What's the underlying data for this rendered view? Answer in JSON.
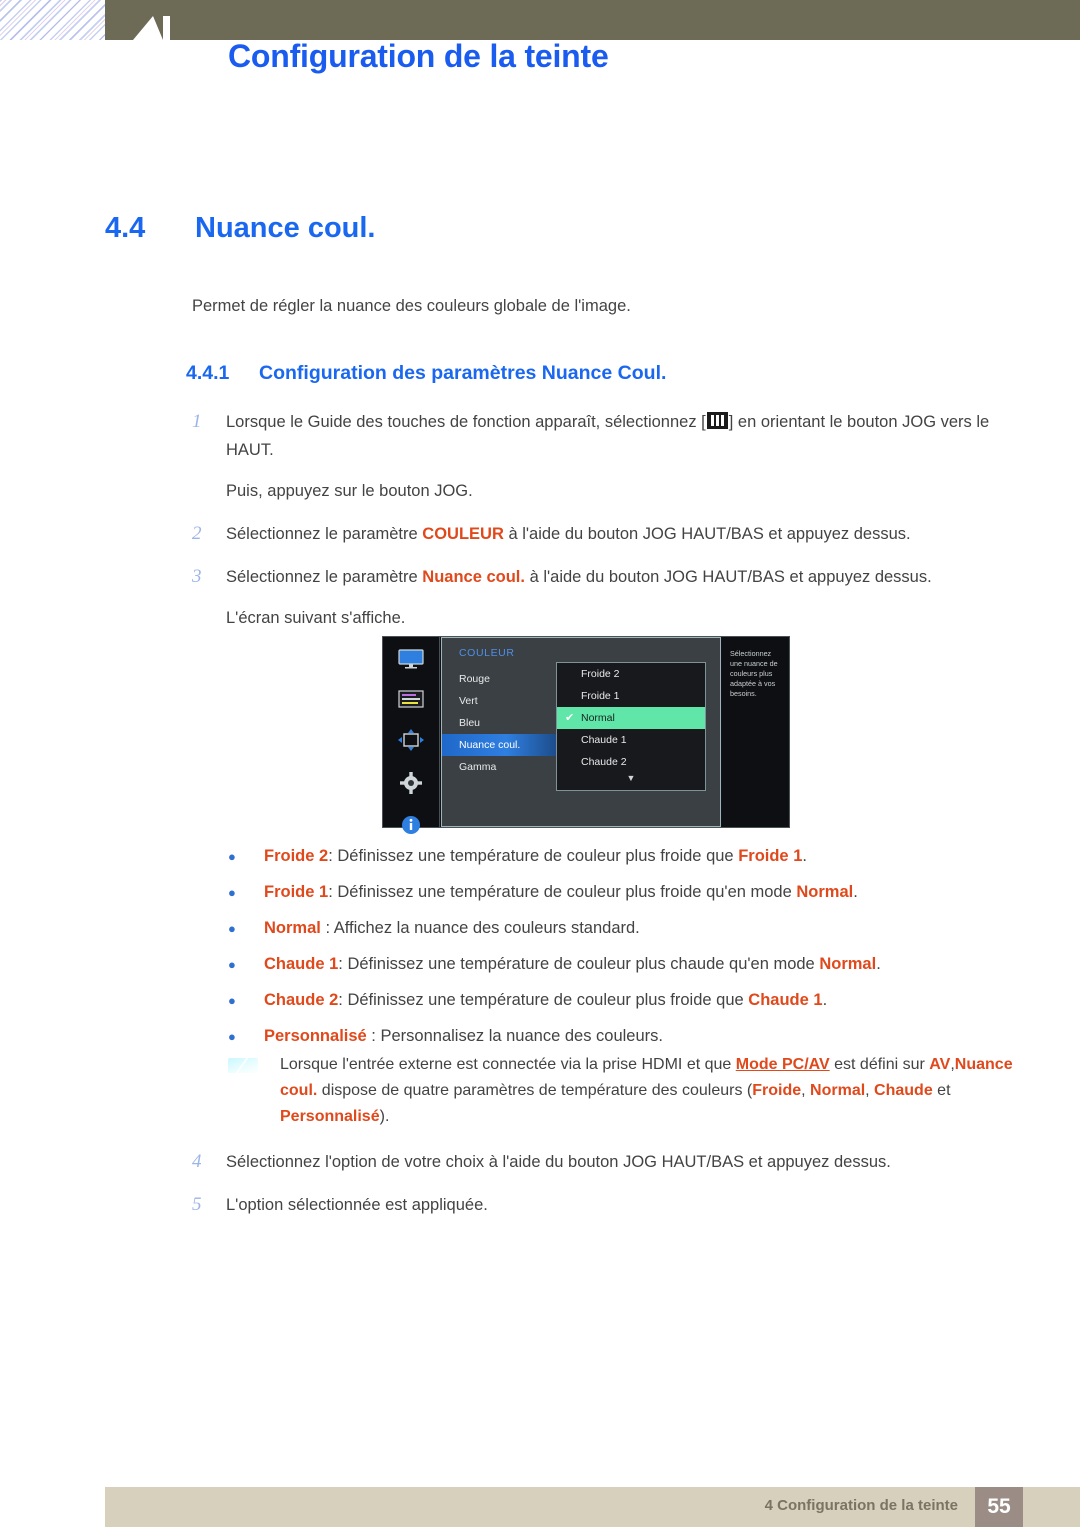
{
  "header": {
    "chapter_number": "4",
    "chapter_title": "Configuration de la teinte"
  },
  "section": {
    "number": "4.4",
    "title": "Nuance coul.",
    "intro": "Permet de régler la nuance des couleurs globale de l'image."
  },
  "subsection": {
    "number": "4.4.1",
    "title": "Configuration des paramètres Nuance Coul."
  },
  "steps": [
    {
      "num": "1",
      "text_before": "Lorsque le Guide des touches de fonction apparaît, sélectionnez [",
      "icon": "jog-menu-icon",
      "text_after": "] en orientant le bouton JOG vers le HAUT.",
      "extra": "Puis, appuyez sur le bouton JOG."
    },
    {
      "num": "2",
      "part1": "Sélectionnez le paramètre ",
      "highlight": "COULEUR",
      "part2": " à l'aide du bouton JOG HAUT/BAS et appuyez dessus."
    },
    {
      "num": "3",
      "part1": "Sélectionnez le paramètre ",
      "highlight": "Nuance coul.",
      "part2": " à l'aide du bouton JOG HAUT/BAS et appuyez dessus.",
      "extra": "L'écran suivant s'affiche."
    }
  ],
  "osd": {
    "rail_icons": [
      "monitor-icon",
      "picture-icon",
      "screen-position-icon",
      "gear-icon",
      "info-icon"
    ],
    "panel_title": "COULEUR",
    "menu_items": [
      {
        "label": "Rouge",
        "selected": false
      },
      {
        "label": "Vert",
        "selected": false
      },
      {
        "label": "Bleu",
        "selected": false
      },
      {
        "label": "Nuance coul.",
        "selected": true
      },
      {
        "label": "Gamma",
        "selected": false
      }
    ],
    "submenu_items": [
      {
        "label": "Froide 2",
        "checked": false
      },
      {
        "label": "Froide 1",
        "checked": false
      },
      {
        "label": "Normal",
        "checked": true
      },
      {
        "label": "Chaude 1",
        "checked": false
      },
      {
        "label": "Chaude 2",
        "checked": false
      }
    ],
    "submenu_more": "▼",
    "check_glyph": "✔",
    "help_text": "Sélectionnez une nuance de couleurs plus adaptée à vos besoins.",
    "colors": {
      "selected_row": "#2f7fe0",
      "checked_row": "#5fe6a8",
      "panel_bg": "#3a4044",
      "title_blue": "#4f8fe8"
    }
  },
  "bullets": [
    {
      "dot": "●",
      "term": "Froide 2",
      "sep": ": ",
      "desc_before": "Définissez une température de couleur plus froide que ",
      "ref": "Froide 1",
      "desc_after": "."
    },
    {
      "dot": "●",
      "term": "Froide 1",
      "sep": ": ",
      "desc_before": "Définissez une température de couleur plus froide qu'en mode ",
      "ref": "Normal",
      "desc_after": "."
    },
    {
      "dot": "●",
      "term": "Normal",
      "sep": " : ",
      "desc_before": "Affichez la nuance des couleurs standard.",
      "ref": "",
      "desc_after": ""
    },
    {
      "dot": "●",
      "term": "Chaude 1",
      "sep": ": ",
      "desc_before": "Définissez une température de couleur plus chaude qu'en mode ",
      "ref": "Normal",
      "desc_after": "."
    },
    {
      "dot": "●",
      "term": "Chaude 2",
      "sep": ": ",
      "desc_before": "Définissez une température de couleur plus froide que ",
      "ref": "Chaude 1",
      "desc_after": "."
    },
    {
      "dot": "●",
      "term": "Personnalisé",
      "sep": " : ",
      "desc_before": "Personnalisez la nuance des couleurs.",
      "ref": "",
      "desc_after": ""
    }
  ],
  "note": {
    "icon": "note-icon",
    "p1": "Lorsque l'entrée externe est connectée via la prise HDMI et que ",
    "link": "Mode PC/AV",
    "p2": " est défini sur ",
    "hl1": "AV",
    "p3": ",",
    "hl2": "Nuance coul.",
    "p4": " dispose de quatre paramètres de température des couleurs (",
    "hl3": "Froide",
    "p5": ", ",
    "hl4": "Normal",
    "p6": ", ",
    "hl5": "Chaude",
    "p7": " et ",
    "hl6": "Personnalisé",
    "p8": ")."
  },
  "steps2": [
    {
      "num": "4",
      "text": "Sélectionnez l'option de votre choix à l'aide du bouton JOG HAUT/BAS et appuyez dessus."
    },
    {
      "num": "5",
      "text": "L'option sélectionnée est appliquée."
    }
  ],
  "footer": {
    "text": "4 Configuration de la teinte",
    "page": "55"
  }
}
